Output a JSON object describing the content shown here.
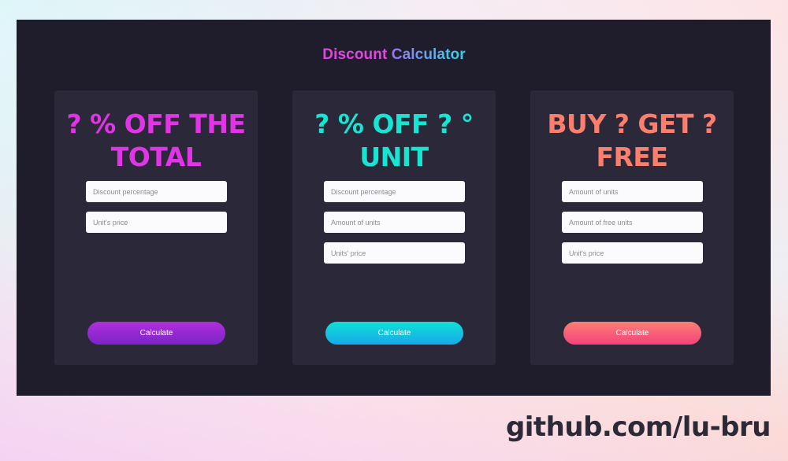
{
  "app": {
    "title_part1": "Discount",
    "title_part2": "Calculator"
  },
  "cards": [
    {
      "heading_line1": "? % OFF THE",
      "heading_line2": "TOTAL",
      "heading_color": "#e034e6",
      "fields": [
        {
          "placeholder": "Discount percentage",
          "value": ""
        },
        {
          "placeholder": "Unit's price",
          "value": ""
        }
      ],
      "button_label": "Calculate",
      "button_gradient": [
        "#b02fdb",
        "#7b24c8"
      ]
    },
    {
      "heading_line1": "? % OFF ? °",
      "heading_line2": "UNIT",
      "heading_color": "#16e5d4",
      "fields": [
        {
          "placeholder": "Discount percentage",
          "value": ""
        },
        {
          "placeholder": "Amount of units",
          "value": ""
        },
        {
          "placeholder": "Units' price",
          "value": ""
        }
      ],
      "button_label": "Calculate",
      "button_gradient": [
        "#10e0d6",
        "#17a9e8"
      ]
    },
    {
      "heading_line1": "BUY ? GET ?",
      "heading_line2": "FREE",
      "heading_color": "#fb7f6c",
      "fields": [
        {
          "placeholder": "Amount of units",
          "value": ""
        },
        {
          "placeholder": "Amount of free units",
          "value": ""
        },
        {
          "placeholder": "Unit's price",
          "value": ""
        }
      ],
      "button_label": "Calculate",
      "button_gradient": [
        "#fb7f73",
        "#f4427b"
      ]
    }
  ],
  "footer": {
    "link_text": "github.com/lu-bru"
  }
}
